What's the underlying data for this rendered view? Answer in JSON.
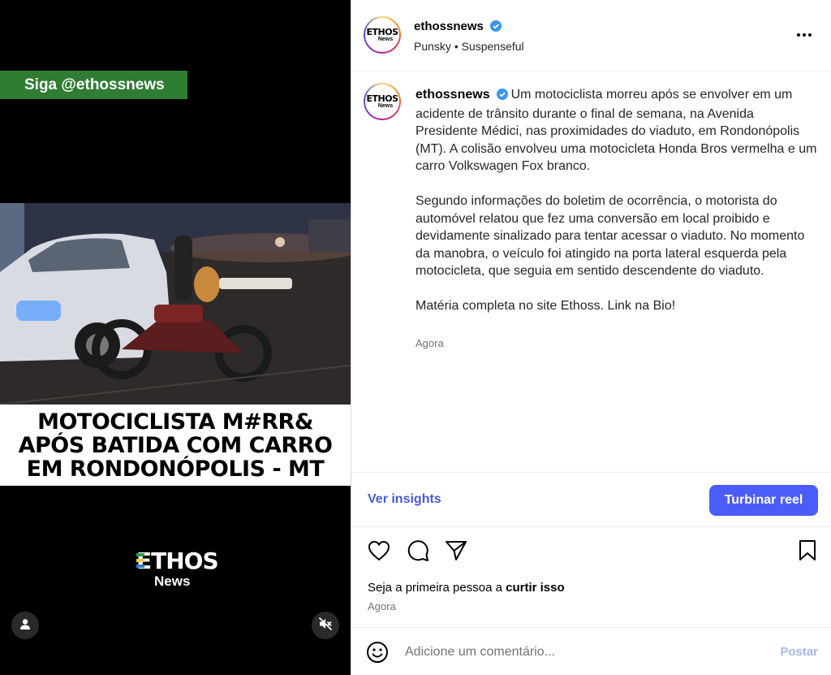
{
  "reel": {
    "follow_banner": "Siga @ethossnews",
    "headline": [
      "MOTOCICLISTA M#RR&",
      "APÓS BATIDA COM CARRO",
      "EM RONDONÓPOLIS - MT"
    ],
    "logo": {
      "line1": "ETHOS",
      "line2": "News"
    },
    "user_icon": "person-icon",
    "mute_icon": "muted-speaker-icon"
  },
  "header": {
    "username": "ethossnews",
    "verified_icon": "verified-badge-icon",
    "audio": "Punsky",
    "separator": "•",
    "track": "Suspenseful",
    "more_icon": "more-options-icon"
  },
  "avatar": {
    "line1": "ETHOS",
    "line2": "News"
  },
  "caption": {
    "username": "ethossnews",
    "paragraphs": [
      "Um motociclista morreu após se envolver em um acidente de trânsito durante o final de semana, na Avenida Presidente Médici, nas proximidades do viaduto, em Rondonópolis (MT). A colisão envolveu uma motocicleta Honda Bros vermelha e um carro Volkswagen Fox branco.",
      "Segundo informações do boletim de ocorrência, o motorista do automóvel relatou que fez uma conversão em local proibido e devidamente sinalizado para tentar acessar o viaduto. No momento da manobra, o veículo foi atingido na porta lateral esquerda pela motocicleta, que seguia em sentido descendente do viaduto.",
      "Matéria completa no site Ethoss. Link na Bio!"
    ],
    "time": "Agora"
  },
  "insights": {
    "link_label": "Ver insights",
    "boost_label": "Turbinar reel"
  },
  "actions": {
    "like_icon": "heart-icon",
    "comment_icon": "comment-icon",
    "share_icon": "send-icon",
    "save_icon": "bookmark-icon"
  },
  "likes": {
    "prefix": "Seja a primeira pessoa a",
    "action": "curtir isso",
    "time": "Agora"
  },
  "comment": {
    "emoji_icon": "emoji-icon",
    "placeholder": "Adicione um comentário...",
    "post_label": "Postar"
  },
  "colors": {
    "accent": "#4a5df9",
    "link": "#4a5bd5",
    "verified": "#3897f0",
    "banner": "#2e7d32",
    "muted_text": "#737373"
  }
}
